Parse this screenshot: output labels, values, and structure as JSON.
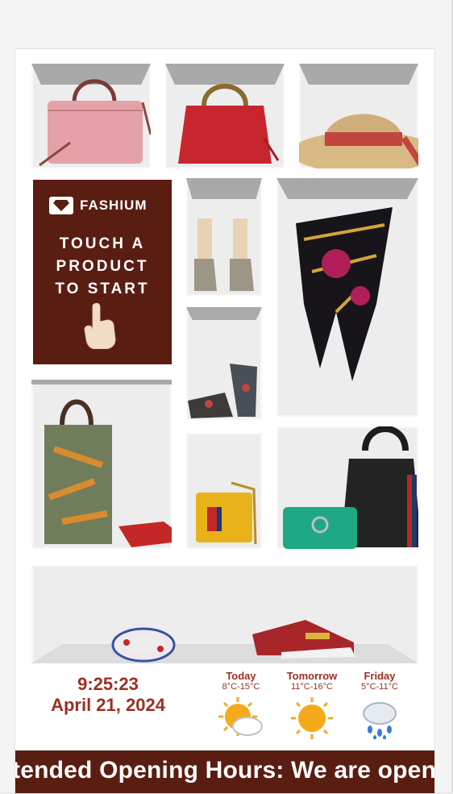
{
  "cta": {
    "brand": "FASHIUM",
    "message_line1": "TOUCH A",
    "message_line2": "PRODUCT",
    "message_line3": "TO START",
    "icons": {
      "logo": "diamond-icon",
      "hand": "pointing-hand-icon"
    }
  },
  "products": [
    {
      "name": "pink-monogram-tote",
      "icon": "handbag-icon"
    },
    {
      "name": "red-bamboo-handbag",
      "icon": "handbag-icon"
    },
    {
      "name": "straw-floral-hat",
      "icon": "hat-icon"
    },
    {
      "name": "platform-sandals",
      "icon": "shoes-icon"
    },
    {
      "name": "printed-silk-scarf",
      "icon": "scarf-icon"
    },
    {
      "name": "floral-platform-pumps",
      "icon": "shoe-icon"
    },
    {
      "name": "tiger-print-tote",
      "icon": "tote-icon"
    },
    {
      "name": "red-leather-gloves",
      "icon": "gloves-icon"
    },
    {
      "name": "yellow-shoulder-bag",
      "icon": "bag-icon"
    },
    {
      "name": "green-shoulder-bag",
      "icon": "bag-icon"
    },
    {
      "name": "black-hobo-bag",
      "icon": "bag-icon"
    },
    {
      "name": "printed-bracelet",
      "icon": "bracelet-icon"
    },
    {
      "name": "embellished-sneakers",
      "icon": "sneaker-icon"
    }
  ],
  "clock": {
    "time": "9:25:23",
    "date": "April 21, 2024"
  },
  "weather": [
    {
      "day": "Today",
      "range": "8°C-15°C",
      "icon": "sun-cloud-icon"
    },
    {
      "day": "Tomorrow",
      "range": "11°C-16°C",
      "icon": "sun-icon"
    },
    {
      "day": "Friday",
      "range": "5°C-11°C",
      "icon": "rain-cloud-icon"
    }
  ],
  "ticker": {
    "text": "tended Opening Hours: We are open"
  },
  "colors": {
    "brand": "#5a1d12",
    "accent": "#9c2f22",
    "shelf": "#ededed",
    "shelf_top": "#a9a9a9"
  }
}
